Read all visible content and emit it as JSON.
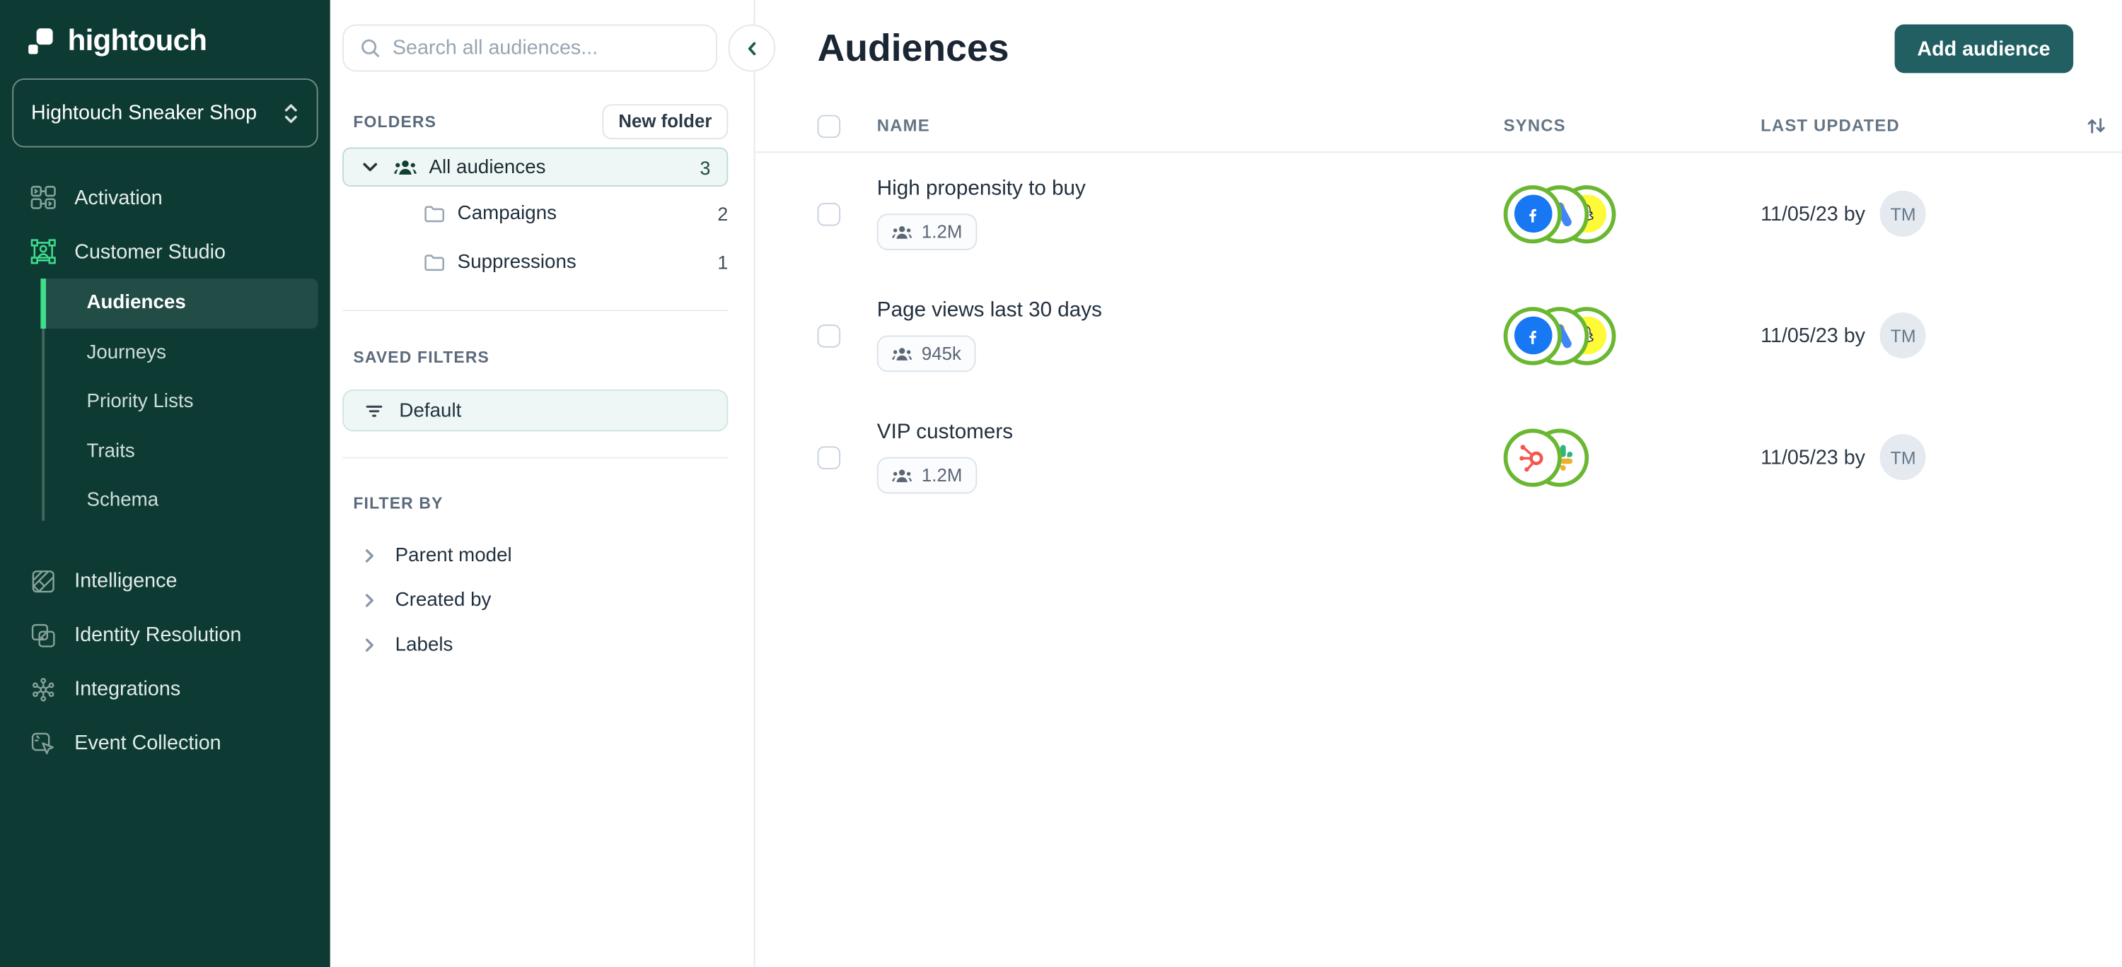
{
  "colors": {
    "sidebar_bg": "#0d3b34",
    "accent_green": "#3fdd8c",
    "button_teal": "#215f63",
    "sync_ring_green": "#6ab731",
    "selected_folder_bg": "#eef7f6",
    "facebook_blue": "#1877F2",
    "snapchat_yellow": "#FFFA37",
    "hubspot_coral": "#f4564d"
  },
  "sidebar": {
    "logo": "hightouch",
    "workspace": "Hightouch Sneaker Shop",
    "nav": {
      "activation": "Activation",
      "customer_studio": "Customer Studio",
      "intelligence": "Intelligence",
      "identity_resolution": "Identity Resolution",
      "integrations": "Integrations",
      "event_collection": "Event Collection"
    },
    "customer_studio_items": {
      "audiences": "Audiences",
      "journeys": "Journeys",
      "priority_lists": "Priority Lists",
      "traits": "Traits",
      "schema": "Schema"
    }
  },
  "panel": {
    "search_placeholder": "Search all audiences...",
    "folders_title": "FOLDERS",
    "new_folder_button": "New folder",
    "tree": {
      "all_audiences": {
        "label": "All audiences",
        "count": "3"
      },
      "campaigns": {
        "label": "Campaigns",
        "count": "2"
      },
      "suppressions": {
        "label": "Suppressions",
        "count": "1"
      }
    },
    "saved_filters_title": "SAVED FILTERS",
    "saved_filters": [
      {
        "label": "Default"
      }
    ],
    "filter_by_title": "FILTER BY",
    "filter_by": [
      {
        "label": "Parent model"
      },
      {
        "label": "Created by"
      },
      {
        "label": "Labels"
      }
    ]
  },
  "main": {
    "title": "Audiences",
    "add_button": "Add audience",
    "table": {
      "headers": {
        "name": "NAME",
        "syncs": "SYNCS",
        "last_updated": "LAST UPDATED"
      },
      "rows": [
        {
          "name": "High propensity to buy",
          "size": "1.2M",
          "syncs": [
            "facebook",
            "google-ads",
            "snapchat"
          ],
          "updated": "11/05/23 by",
          "avatar_initials": "TM"
        },
        {
          "name": "Page views last 30 days",
          "size": "945k",
          "syncs": [
            "facebook",
            "google-ads",
            "snapchat"
          ],
          "updated": "11/05/23 by",
          "avatar_initials": "TM"
        },
        {
          "name": "VIP customers",
          "size": "1.2M",
          "syncs": [
            "hubspot",
            "slack"
          ],
          "updated": "11/05/23 by",
          "avatar_initials": "TM"
        }
      ]
    }
  }
}
